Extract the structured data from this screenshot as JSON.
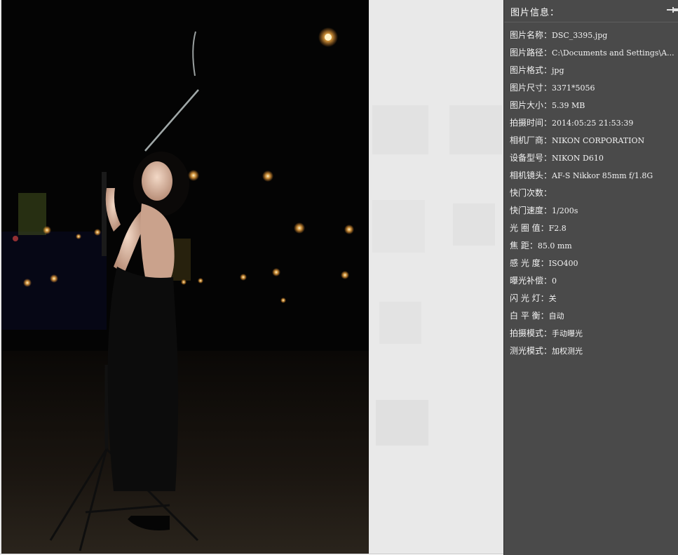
{
  "panel": {
    "title": "图片信息：",
    "pin_icon": "pin-icon",
    "rows": [
      {
        "label": "图片名称：",
        "value": "DSC_3395.jpg"
      },
      {
        "label": "图片路径：",
        "value": "C:\\Documents and Settings\\A..."
      },
      {
        "label": "图片格式：",
        "value": "jpg"
      },
      {
        "label": "图片尺寸：",
        "value": "3371*5056"
      },
      {
        "label": "图片大小：",
        "value": "5.39 MB"
      },
      {
        "label": "拍摄时间：",
        "value": "2014:05:25 21:53:39"
      },
      {
        "label": "相机厂商：",
        "value": "NIKON CORPORATION"
      },
      {
        "label": "设备型号：",
        "value": "NIKON D610"
      },
      {
        "label": "相机镜头：",
        "value": "AF-S Nikkor 85mm f/1.8G"
      },
      {
        "label": "快门次数：",
        "value": ""
      },
      {
        "label": "快门速度：",
        "value": "1/200s"
      },
      {
        "label": "光 圈 值：",
        "value": "F2.8"
      },
      {
        "label": "焦    距：",
        "value": "85.0 mm"
      },
      {
        "label": "感 光 度：",
        "value": "ISO400"
      },
      {
        "label": "曝光补偿：",
        "value": "0"
      },
      {
        "label": "闪 光 灯：",
        "value": "关"
      },
      {
        "label": "白 平 衡：",
        "value": "自动"
      },
      {
        "label": "拍摄模式：",
        "value": "手动曝光"
      },
      {
        "label": "测光模式：",
        "value": "加权测光"
      }
    ]
  },
  "colors": {
    "panel_bg": "#4a4a4a",
    "viewer_bg": "#e9e9e9",
    "photo_bg": "#050505",
    "text": "#f2f2f2"
  }
}
